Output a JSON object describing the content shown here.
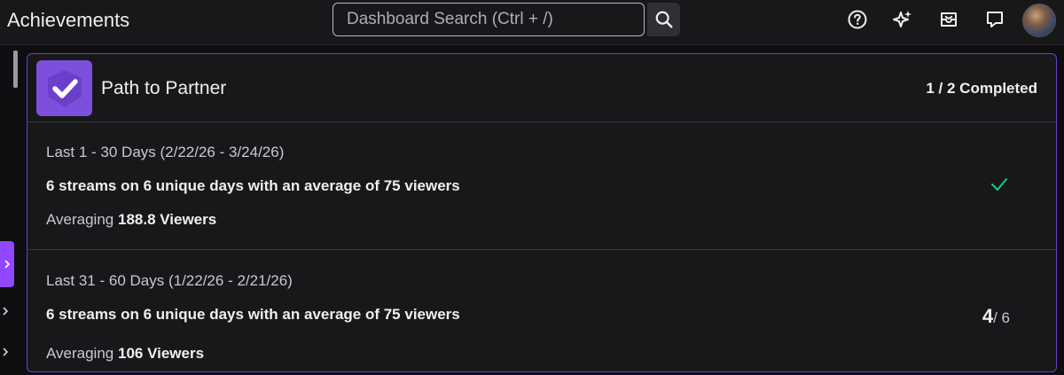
{
  "header": {
    "title": "Achievements",
    "search_placeholder": "Dashboard Search (Ctrl + /)"
  },
  "icons": {
    "search": "search-icon",
    "help": "help-icon",
    "sparkle": "sparkle-icon",
    "inbox": "inbox-icon",
    "whispers": "whispers-icon"
  },
  "colors": {
    "accent": "#9147ff",
    "check": "#00d68a",
    "card_border": "#6b3fcf"
  },
  "card": {
    "title": "Path to Partner",
    "status": "1 / 2 Completed",
    "rows": [
      {
        "period": "Last 1 - 30 Days (2/22/26 - 3/24/26)",
        "requirement": "6 streams on 6 unique days with an average of 75 viewers",
        "avg_prefix": "Averaging",
        "avg_value": "188.8 Viewers"
      },
      {
        "period": "Last 31 - 60 Days (1/22/26 - 2/21/26)",
        "requirement": "6 streams on 6 unique days with an average of 75 viewers",
        "avg_prefix": "Averaging",
        "avg_value": "106 Viewers",
        "progress_current": "4",
        "progress_total": "/ 6"
      }
    ]
  }
}
